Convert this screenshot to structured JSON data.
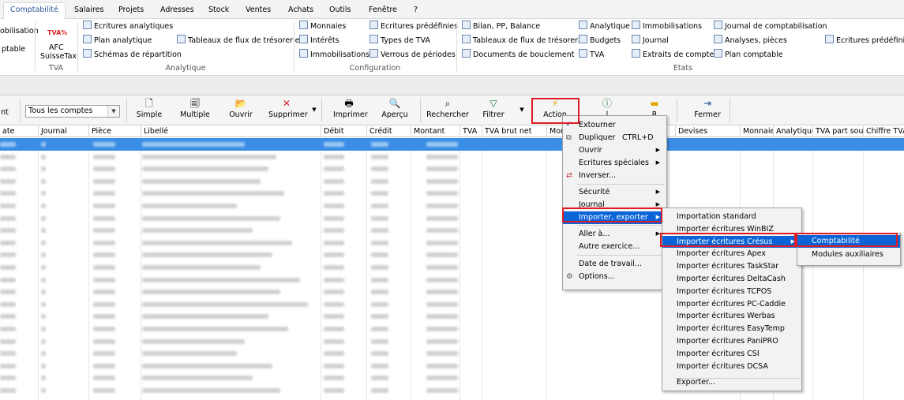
{
  "tabs": [
    "Comptabilité",
    "Salaires",
    "Projets",
    "Adresses",
    "Stock",
    "Ventes",
    "Achats",
    "Outils",
    "Fenêtre",
    "?"
  ],
  "ribbon": {
    "left_cut": [
      "obilisation",
      "ptable"
    ],
    "tva_logo": "TVA%",
    "afc": [
      "AFC",
      "SuisseTax"
    ],
    "tva_group": "TVA",
    "analytique": [
      "Ecritures analytiques",
      "Plan analytique",
      "Schémas de répartition"
    ],
    "flux": "Tableaux de flux de trésorerie",
    "analytique_group": "Analytique",
    "config_col1": [
      "Monnaies",
      "Intérêts",
      "Immobilisations"
    ],
    "config_col2": [
      "Ecritures prédéfinies",
      "Types de TVA",
      "Verrous de périodes"
    ],
    "config_group": "Configuration",
    "etats_col1": [
      "Bilan, PP, Balance",
      "Tableaux de flux de trésorerie",
      "Documents de bouclement"
    ],
    "etats_col2": [
      "Analytique",
      "Budgets",
      "TVA"
    ],
    "etats_col3": [
      "Immobilisations",
      "Journal",
      "Extraits de comptes"
    ],
    "etats_col4": [
      "Journal de comptabilisation",
      "Analyses, pièces",
      "Plan comptable"
    ],
    "etats_col5": "Ecritures prédéfinies",
    "etats_group": "Etats"
  },
  "toolbar": {
    "left_cut": "nt",
    "combo": "Tous les comptes",
    "buttons": [
      "Simple",
      "Multiple",
      "Ouvrir",
      "Supprimer",
      "Imprimer",
      "Aperçu",
      "Rechercher",
      "Filtrer",
      "Action",
      "",
      "",
      "Fermer"
    ],
    "partial": [
      "l",
      "R"
    ]
  },
  "columns": [
    "ate",
    "Journal",
    "Pièce",
    "Libellé",
    "Débit",
    "Crédit",
    "Montant",
    "TVA",
    "TVA brut net",
    "Mon",
    "Devises",
    "Monnaie",
    "Analytique",
    "TVA part soumi",
    "Chiffre TVA"
  ],
  "menu_main": [
    {
      "label": "Extourner",
      "icon": "undo-icon"
    },
    {
      "label": "Dupliquer",
      "accel": "CTRL+D",
      "icon": "copy-icon"
    },
    {
      "label": "Ouvrir",
      "sub": true
    },
    {
      "label": "Ecritures spéciales",
      "sub": true
    },
    {
      "label": "Inverser...",
      "icon": "swap-icon"
    },
    {
      "label": "Sécurité",
      "sub": true
    },
    {
      "label": "Journal",
      "sub": true
    },
    {
      "label": "Importer, exporter",
      "sub": true
    },
    {
      "label": "Aller à...",
      "sub": true
    },
    {
      "label": "Autre exercice..."
    },
    {
      "label": "Date de travail..."
    },
    {
      "label": "Options...",
      "icon": "options-icon"
    }
  ],
  "menu_import": [
    "Importation standard",
    "Importer écritures WinBIZ",
    "Importer écritures Crésus",
    "Importer écritures Apex",
    "Importer écritures TaskStar",
    "Importer écritures DeltaCash",
    "Importer écritures TCPOS",
    "Importer écritures PC-Caddie",
    "Importer écritures Werbas",
    "Importer écritures EasyTemp",
    "Importer écritures PaniPRO",
    "Importer écritures CSI",
    "Importer écritures DCSA",
    "Exporter..."
  ],
  "menu_cresus": [
    "Comptabilité",
    "Modules auxiliaires"
  ],
  "colors": {
    "accent": "#2b579a",
    "selection": "#0a64d8",
    "highlight_box": "#e01b24"
  }
}
